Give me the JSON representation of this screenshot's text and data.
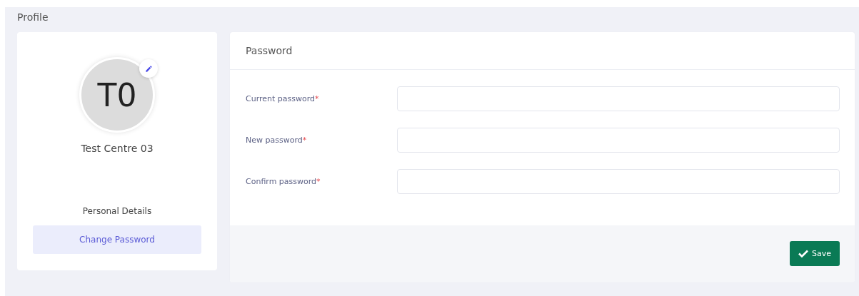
{
  "page": {
    "title": "Profile"
  },
  "profile": {
    "initials": "T0",
    "name": "Test Centre 03"
  },
  "menu": [
    {
      "label": "Personal Details",
      "selected": false
    },
    {
      "label": "Change Password",
      "selected": true
    }
  ],
  "password_panel": {
    "title": "Password",
    "fields": [
      {
        "label": "Current password",
        "required_mark": "*"
      },
      {
        "label": "New password",
        "required_mark": "*"
      },
      {
        "label": "Confirm password",
        "required_mark": "*"
      }
    ],
    "save_button": "Save"
  }
}
